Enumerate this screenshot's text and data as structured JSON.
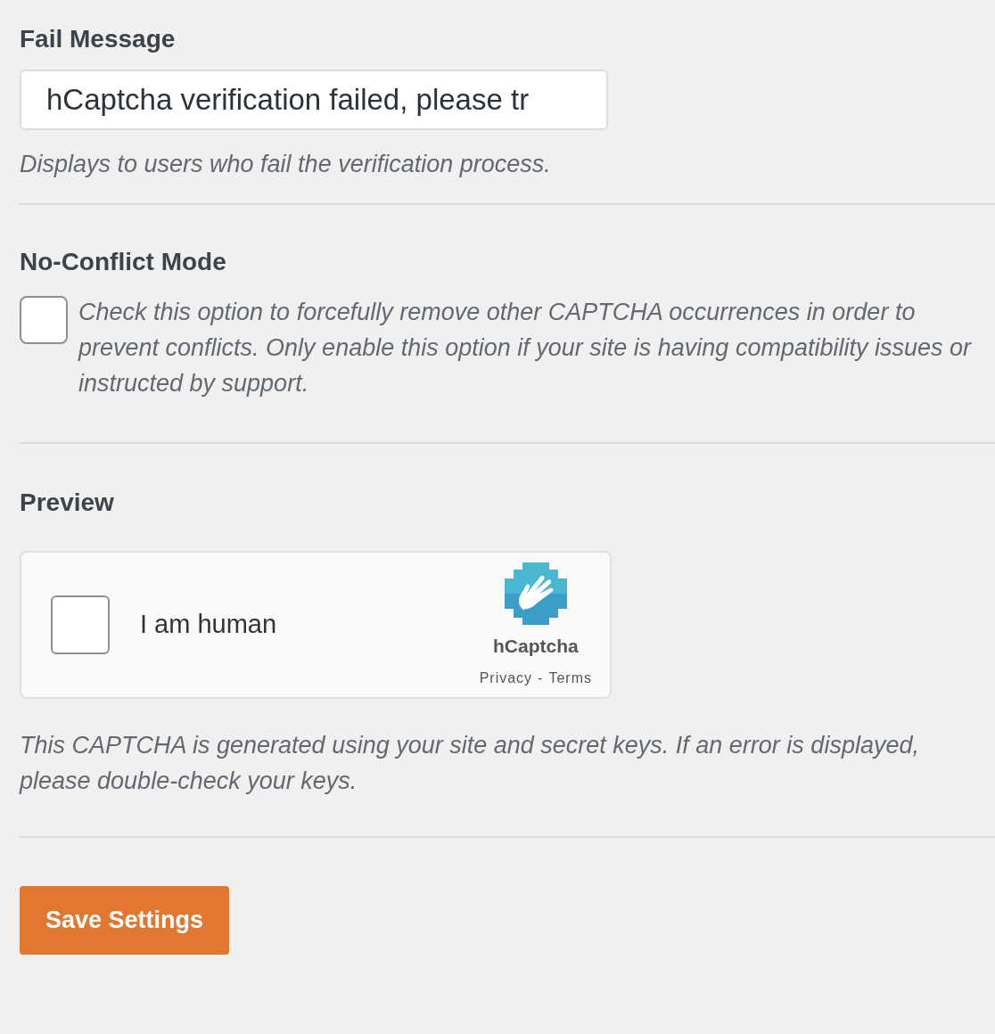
{
  "fail_message": {
    "heading": "Fail Message",
    "value": "hCaptcha verification failed, please tr",
    "description": "Displays to users who fail the verification process."
  },
  "no_conflict": {
    "heading": "No-Conflict Mode",
    "checked": false,
    "description": "Check this option to forcefully remove other CAPTCHA occurrences in order to prevent conflicts. Only enable this option if your site is having compatibility issues or instructed by support."
  },
  "preview": {
    "heading": "Preview",
    "widget": {
      "checked": false,
      "label": "I am human",
      "brand": "hCaptcha",
      "privacy_link": "Privacy",
      "separator": "-",
      "terms_link": "Terms"
    },
    "description": "This CAPTCHA is generated using your site and secret keys. If an error is displayed, please double-check your keys."
  },
  "save_button": "Save Settings"
}
